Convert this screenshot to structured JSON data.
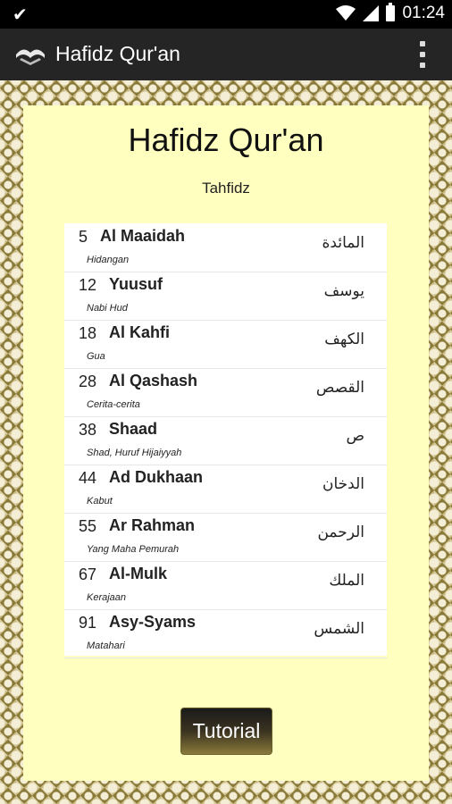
{
  "statusbar": {
    "time": "01:24"
  },
  "appbar": {
    "title": "Hafidz Qur'an"
  },
  "main": {
    "title": "Hafidz Qur'an",
    "subtitle": "Tahfidz",
    "surahs": [
      {
        "number": "5",
        "name": "Al Maaidah",
        "meaning": "Hidangan",
        "arabic": "المائدة"
      },
      {
        "number": "12",
        "name": "Yuusuf",
        "meaning": "Nabi Hud",
        "arabic": "يوسف"
      },
      {
        "number": "18",
        "name": "Al Kahfi",
        "meaning": "Gua",
        "arabic": "الكهف"
      },
      {
        "number": "28",
        "name": "Al Qashash",
        "meaning": "Cerita-cerita",
        "arabic": "القصص"
      },
      {
        "number": "38",
        "name": "Shaad",
        "meaning": "Shad, Huruf Hijaiyyah",
        "arabic": "ص"
      },
      {
        "number": "44",
        "name": "Ad Dukhaan",
        "meaning": "Kabut",
        "arabic": "الدخان"
      },
      {
        "number": "55",
        "name": "Ar Rahman",
        "meaning": "Yang Maha Pemurah",
        "arabic": "الرحمن"
      },
      {
        "number": "67",
        "name": "Al-Mulk",
        "meaning": "Kerajaan",
        "arabic": "الملك"
      },
      {
        "number": "91",
        "name": "Asy-Syams",
        "meaning": "Matahari",
        "arabic": "الشمس"
      }
    ],
    "tutorial_label": "Tutorial"
  },
  "colors": {
    "panel": "#ffffbf",
    "appbar": "#252525",
    "frame": "#8a7a3a"
  }
}
